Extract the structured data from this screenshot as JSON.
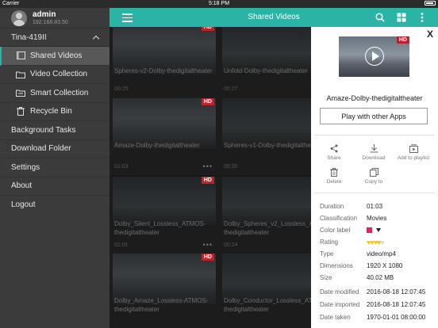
{
  "status_bar": {
    "carrier": "Carrier",
    "time": "5:18 PM",
    "battery": ""
  },
  "sidebar": {
    "user_name": "admin",
    "user_ip": "192.168.83.50",
    "nas_name": "Tina-419II",
    "sub_items": [
      {
        "label": "Shared Videos",
        "icon": "shared-video-icon",
        "active": true
      },
      {
        "label": "Video Collection",
        "icon": "folder-icon",
        "active": false
      },
      {
        "label": "Smart Collection",
        "icon": "smart-folder-icon",
        "active": false
      },
      {
        "label": "Recycle Bin",
        "icon": "trash-icon",
        "active": false
      }
    ],
    "main_items": [
      {
        "label": "Background Tasks"
      },
      {
        "label": "Download Folder"
      },
      {
        "label": "Settings"
      },
      {
        "label": "About"
      },
      {
        "label": "Logout"
      }
    ]
  },
  "header": {
    "title": "Shared Videos"
  },
  "videos": [
    {
      "name": "Spheres-v2-Dolby-thedigitaltheater",
      "time": "00:25",
      "hd": "HD"
    },
    {
      "name": "Unfold-Dolby-thedigitaltheater",
      "time": "00:27",
      "hd": "HD"
    },
    {
      "name": "Amaze-Dolby-thedigitaltheater",
      "time": "01:03",
      "hd": "HD"
    },
    {
      "name": "Spheres-v1-Dolby-thedigitaltheater",
      "time": "00:30",
      "hd": ""
    },
    {
      "name": "Dolby_Silent_Lossless_ATMOS-thedigitaltheater",
      "time": "01:01",
      "hd": "HD"
    },
    {
      "name": "Dolby_Spheres_v2_Lossless_ATMOS-thedigitaltheater",
      "time": "00:24",
      "hd": ""
    },
    {
      "name": "Dolby_Amaze_Lossless-ATMOS-thedigitaltheater",
      "time": "",
      "hd": "HD"
    },
    {
      "name": "Dolby_Conductor_Lossless_ATMOS-thedigitaltheater",
      "time": "",
      "hd": ""
    }
  ],
  "panel": {
    "close": "X",
    "hd": "HD",
    "title": "Amaze-Dolby-thedigitaltheater",
    "play_button": "Play with other Apps",
    "actions": [
      {
        "label": "Share",
        "icon": "share-icon"
      },
      {
        "label": "Download",
        "icon": "download-icon"
      },
      {
        "label": "Add to playlist",
        "icon": "playlist-icon"
      },
      {
        "label": "Delete",
        "icon": "trash-icon"
      },
      {
        "label": "Copy to",
        "icon": "copy-icon"
      }
    ],
    "info": [
      {
        "key": "Duration",
        "value": "01:03"
      },
      {
        "key": "Classification",
        "value": "Movies"
      },
      {
        "key": "Color label",
        "value": ""
      },
      {
        "key": "Rating",
        "value": ""
      },
      {
        "key": "Type",
        "value": "video/mp4"
      },
      {
        "key": "Dimensions",
        "value": "1920 X 1080"
      },
      {
        "key": "Size",
        "value": "40.02 MB"
      },
      {
        "key": "Date modified",
        "value": "2016-08-18 12:07:45"
      },
      {
        "key": "Date imported",
        "value": "2016-08-18 12:07:45"
      },
      {
        "key": "Date taken",
        "value": "1970-01-01 08:00:00"
      }
    ],
    "color_label_color": "#e0245e",
    "rating_stars": 4,
    "rating_max": 5
  },
  "colors": {
    "accent": "#2bb3a6",
    "hd_badge": "#b8252a",
    "sidebar": "#3b3b3b"
  }
}
